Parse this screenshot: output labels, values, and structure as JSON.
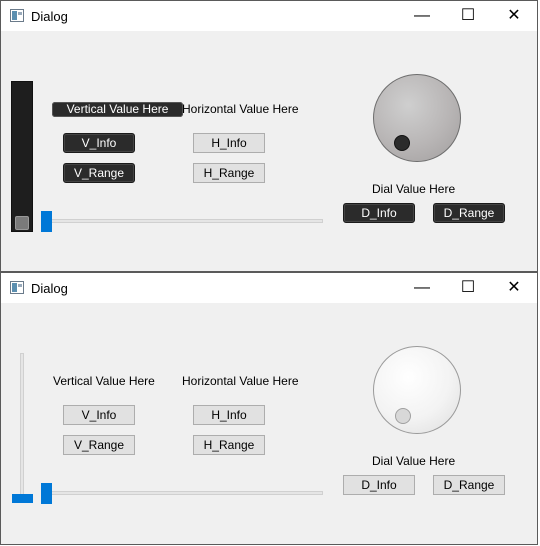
{
  "windows": [
    {
      "title": "Dialog",
      "vertical_label": "Vertical Value Here",
      "horizontal_label": "Horizontal Value Here",
      "dial_label": "Dial Value Here",
      "v_info": "V_Info",
      "v_range": "V_Range",
      "h_info": "H_Info",
      "h_range": "H_Range",
      "d_info": "D_Info",
      "d_range": "D_Range",
      "vertical_slider_value": 0,
      "horizontal_slider_value": 0
    },
    {
      "title": "Dialog",
      "vertical_label": "Vertical Value Here",
      "horizontal_label": "Horizontal Value Here",
      "dial_label": "Dial Value Here",
      "v_info": "V_Info",
      "v_range": "V_Range",
      "h_info": "H_Info",
      "h_range": "H_Range",
      "d_info": "D_Info",
      "d_range": "D_Range",
      "vertical_slider_value": 0,
      "horizontal_slider_value": 0
    }
  ],
  "titlebar": {
    "minimize": "—",
    "maximize": "☐",
    "close": "✕"
  },
  "colors": {
    "accent": "#0078d7",
    "dark_widget": "#2b2b2b",
    "window_bg": "#f0f0f0"
  }
}
